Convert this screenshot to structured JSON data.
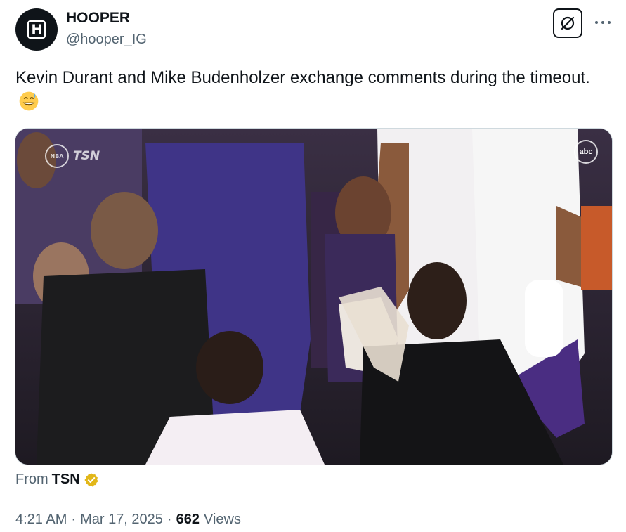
{
  "author": {
    "display_name": "HOOPER",
    "handle": "@hooper_IG",
    "avatar_icon": "hooper-logo-icon"
  },
  "actions": {
    "grok_icon": "grok-icon",
    "more_icon": "more-dots-icon"
  },
  "tweet": {
    "text": "Kevin Durant and Mike Budenholzer exchange comments during the timeout.",
    "emoji": "grinning-face-with-sweat-emoji"
  },
  "media": {
    "kind": "video-still",
    "broadcast_bug_left": "TSN",
    "broadcast_bug_right": "abc"
  },
  "source": {
    "prefix": "From",
    "name": "TSN",
    "badge_icon": "verified-gold-badge-icon"
  },
  "meta": {
    "time": "4:21 AM",
    "separator": "·",
    "date": "Mar 17, 2025",
    "views_count": "662",
    "views_label": "Views"
  },
  "colors": {
    "text_primary": "#0f1419",
    "text_secondary": "#536471",
    "verified_gold": "#e2b719"
  }
}
